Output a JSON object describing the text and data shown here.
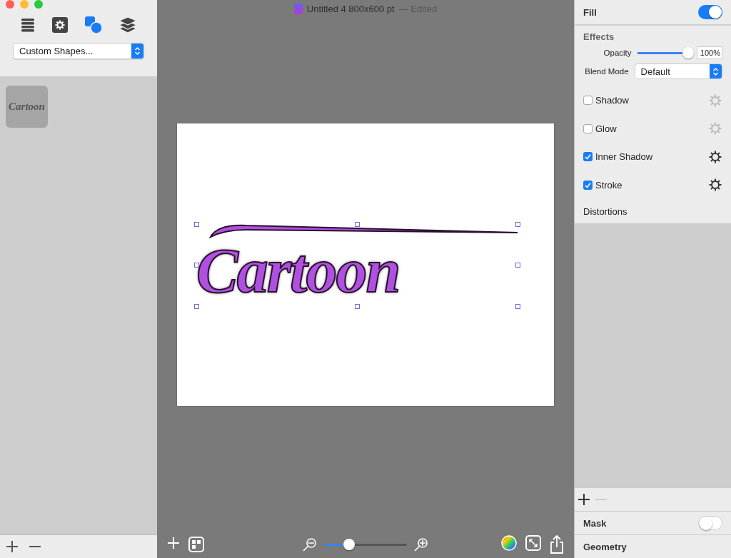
{
  "window": {
    "title": "Untitled 4 800x600 pt",
    "status": "— Edited"
  },
  "sidebar": {
    "tabs": [
      {
        "kind": "list",
        "selected": false
      },
      {
        "kind": "settings",
        "selected": false
      },
      {
        "kind": "shapes",
        "selected": true
      },
      {
        "kind": "layers",
        "selected": false
      }
    ],
    "dropdown": {
      "value": "Custom Shapes..."
    },
    "thumbnails": [
      {
        "text": "Cartoon"
      }
    ]
  },
  "canvas": {
    "artwork_text": "Cartoon",
    "selected": true
  },
  "toolbar": {
    "zoom": {
      "level": 0.3
    }
  },
  "inspector": {
    "fill": {
      "label": "Fill",
      "on": true
    },
    "effects": {
      "title": "Effects",
      "opacity": {
        "label": "Opacity",
        "level": 0.95,
        "value": "100%"
      },
      "blend_mode": {
        "label": "Blend Mode",
        "value": "Default"
      },
      "items": [
        {
          "label": "Shadow",
          "checked": false
        },
        {
          "label": "Glow",
          "checked": false
        },
        {
          "label": "Inner Shadow",
          "checked": true
        },
        {
          "label": "Stroke",
          "checked": true
        }
      ]
    },
    "distortions": {
      "title": "Distortions",
      "remove_disabled": true
    },
    "mask": {
      "label": "Mask",
      "on": false
    },
    "geometry": {
      "title": "Geometry"
    }
  }
}
